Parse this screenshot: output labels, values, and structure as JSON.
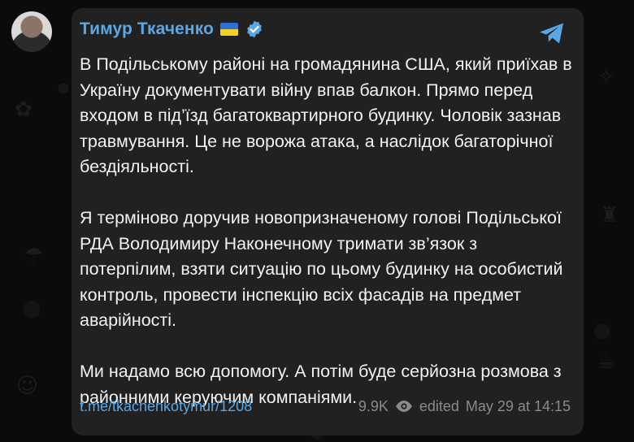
{
  "post": {
    "author": "Тимур Ткаченко",
    "paragraphs": [
      "В Подільському районі на громадянина США, який приїхав в Україну документувати війну впав балкон. Прямо перед входом в під’їзд багатоквартирного будинку. Чоловік зазнав травмування. Це не ворожа атака, а наслідок багаторічної бездіяльності.",
      "Я терміново доручив новопризначеному голові Подільської РДА Володимиру Наконечному тримати зв’язок з потерпілим, взяти ситуацію по цьому будинку на особистий контроль, провести інспекцію всіх фасадів на предмет аварійності.",
      "Ми надамо всю допомогу. А потім буде серйозна розмова з районними керуючим компаніями."
    ],
    "link": "t.me/tkachenkotymur/1208",
    "views": "9.9K",
    "edited_label": "edited",
    "timestamp": "May 29 at 14:15"
  },
  "icons": {
    "flag": "ukraine-flag-icon",
    "verified": "verified-badge-icon",
    "share": "telegram-share-icon",
    "views": "eye-icon"
  },
  "colors": {
    "accent": "#5aa7e6",
    "bubble": "#212121",
    "text": "#f2f2f2",
    "muted": "#8a8a8a"
  }
}
